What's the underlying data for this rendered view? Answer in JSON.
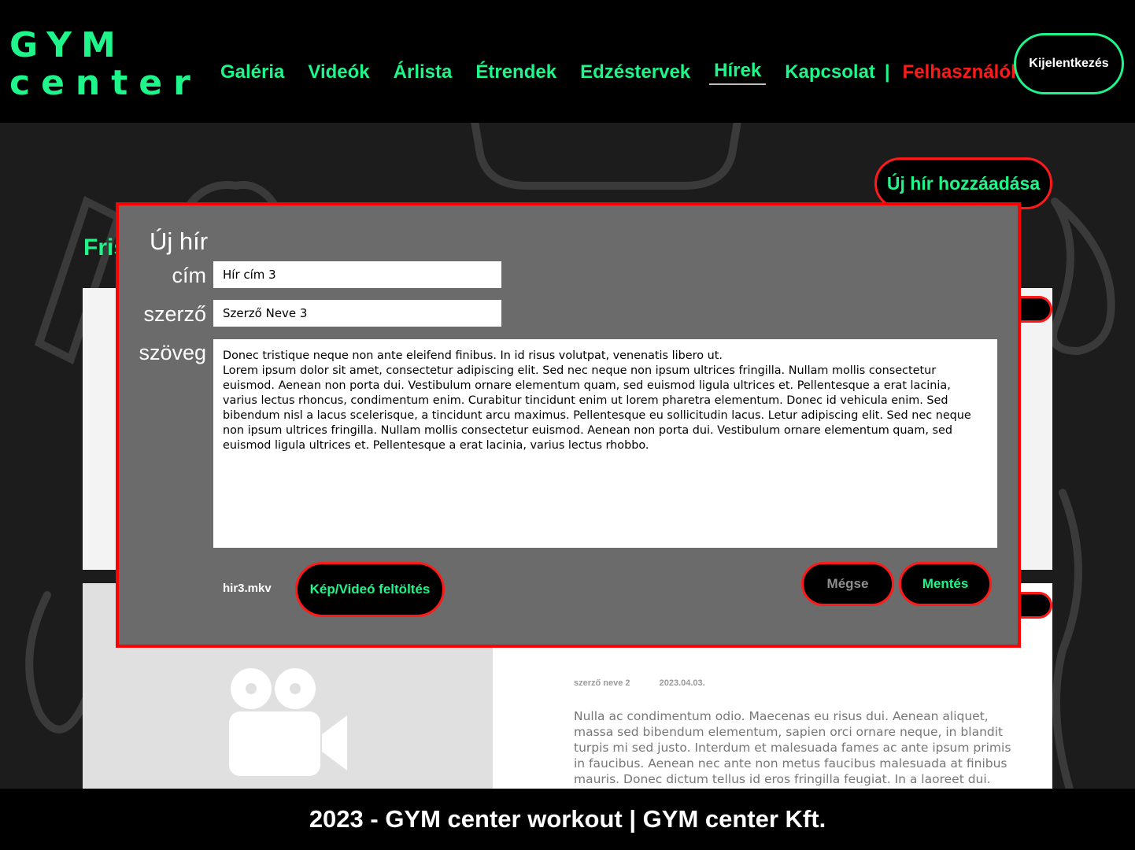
{
  "header": {
    "logo_line1": "GYM",
    "logo_line2": "center",
    "nav": [
      {
        "label": "Galéria"
      },
      {
        "label": "Videók"
      },
      {
        "label": "Árlista"
      },
      {
        "label": "Étrendek"
      },
      {
        "label": "Edzéstervek"
      },
      {
        "label": "Hírek",
        "active": true
      },
      {
        "label": "Kapcsolat"
      },
      {
        "label": "Felhasználók"
      }
    ],
    "separator": "|",
    "logout_label": "Kijelentkezés"
  },
  "page": {
    "add_news_label": "Új hír hozzáadása",
    "section_title": "Friss hírek",
    "card2": {
      "author": "szerző neve 2",
      "date": "2023.04.03.",
      "text": "Nulla ac condimentum odio. Maecenas eu risus dui. Aenean aliquet, massa sed bibendum elementum, sapien orci ornare neque, in blandit turpis mi sed justo. Interdum et malesuada fames ac ante ipsum primis in faucibus. Aenean nec ante non metus faucibus malesuada at finibus mauris. Donec dictum tellus id eros fringilla feugiat. In a laoreet dui. Nulla sodales orci felis,"
    }
  },
  "modal": {
    "title": "Új hír",
    "title_label": "cím",
    "title_value": "Hír cím 3",
    "author_label": "szerző",
    "author_value": "Szerző Neve 3",
    "text_label": "szöveg",
    "text_value": "Donec tristique neque non ante eleifend finibus. In id risus volutpat, venenatis libero ut.\nLorem ipsum dolor sit amet, consectetur adipiscing elit. Sed nec neque non ipsum ultrices fringilla. Nullam mollis consectetur euismod. Aenean non porta dui. Vestibulum ornare elementum quam, sed euismod ligula ultrices et. Pellentesque a erat lacinia, varius lectus rhoncus, condimentum enim. Curabitur tincidunt enim ut lorem pharetra elementum. Donec id vehicula enim. Sed bibendum nisl a lacus scelerisque, a tincidunt arcu maximus. Pellentesque eu sollicitudin lacus. Letur adipiscing elit. Sed nec neque non ipsum ultrices fringilla. Nullam mollis consectetur euismod. Aenean non porta dui. Vestibulum ornare elementum quam, sed euismod ligula ultrices et. Pellentesque a erat lacinia, varius lectus rhobbo.",
    "filename": "hir3.mkv",
    "upload_label": "Kép/Videó feltöltés",
    "cancel_label": "Mégse",
    "save_label": "Mentés"
  },
  "footer": {
    "text": "2023 - GYM center workout | GYM center Kft."
  },
  "colors": {
    "accent": "#1ef58a",
    "danger": "#ff1a1a",
    "modal_bg": "#6b6b6b"
  }
}
